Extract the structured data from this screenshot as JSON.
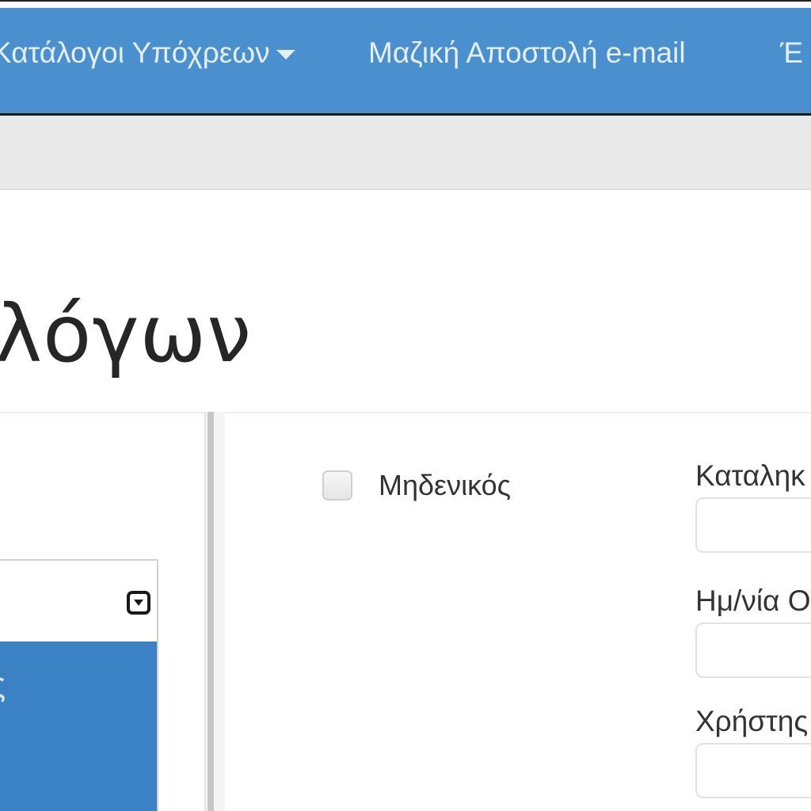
{
  "nav": {
    "items": [
      {
        "label": "Κατάλογοι Υπόχρεων",
        "dropdown": true
      },
      {
        "label": "Μαζική Αποστολή e-mail",
        "dropdown": false
      },
      {
        "label": "Έ",
        "dropdown": false
      }
    ]
  },
  "page": {
    "title": "λόγων"
  },
  "left_panel": {
    "glyph": "ς"
  },
  "form": {
    "checkbox_label": "Μηδενικός",
    "fields": [
      {
        "label": "Καταληκ",
        "value": ""
      },
      {
        "label": "Ημ/νία Ο",
        "value": ""
      },
      {
        "label": "Χρήστης",
        "value": ""
      }
    ]
  },
  "colors": {
    "navbar": "#4a90cf",
    "nav_text": "#e6eef8",
    "selected_row": "#3a82c4"
  }
}
